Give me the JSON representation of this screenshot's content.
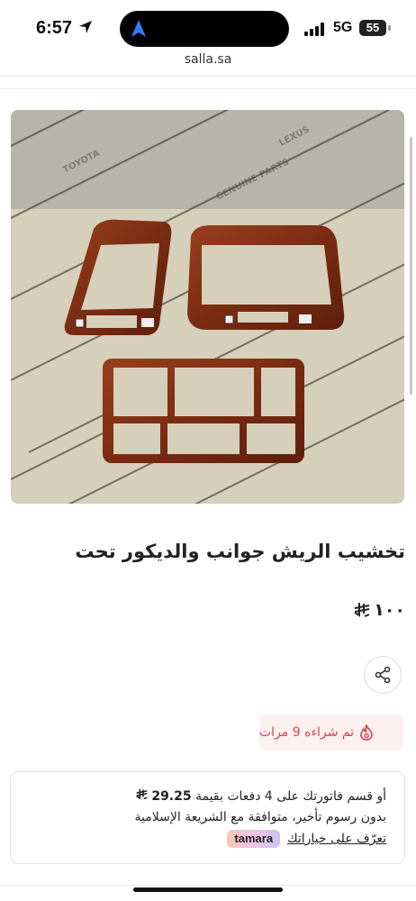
{
  "status_bar": {
    "time": "6:57",
    "network": "5G",
    "battery": "55"
  },
  "browser": {
    "url": "salla.sa"
  },
  "product": {
    "title": "تخشيب الريش جوانب والديكور تحت",
    "price": "١٠٠",
    "currency_icon": "riyal-symbol-icon",
    "sold_text": "تم شراءه 9 مرات",
    "sold_color": "#d9424f"
  },
  "tamara": {
    "line1_prefix": "أو قسم فاتورتك على 4 دفعات بقيمة",
    "amount": "29.25",
    "line2": "بدون رسوم تأخير، متوافقة مع الشريعة الإسلامية",
    "learn_more": "تعرّف على خياراتك",
    "badge": "tamara"
  },
  "icons": {
    "wishlist": "heart-icon",
    "share": "share-icon",
    "location": "location-arrow-icon",
    "sold": "fire-icon"
  },
  "image_watermark": [
    "TOYOTA",
    "LEXUS",
    "GENUINE PARTS"
  ]
}
